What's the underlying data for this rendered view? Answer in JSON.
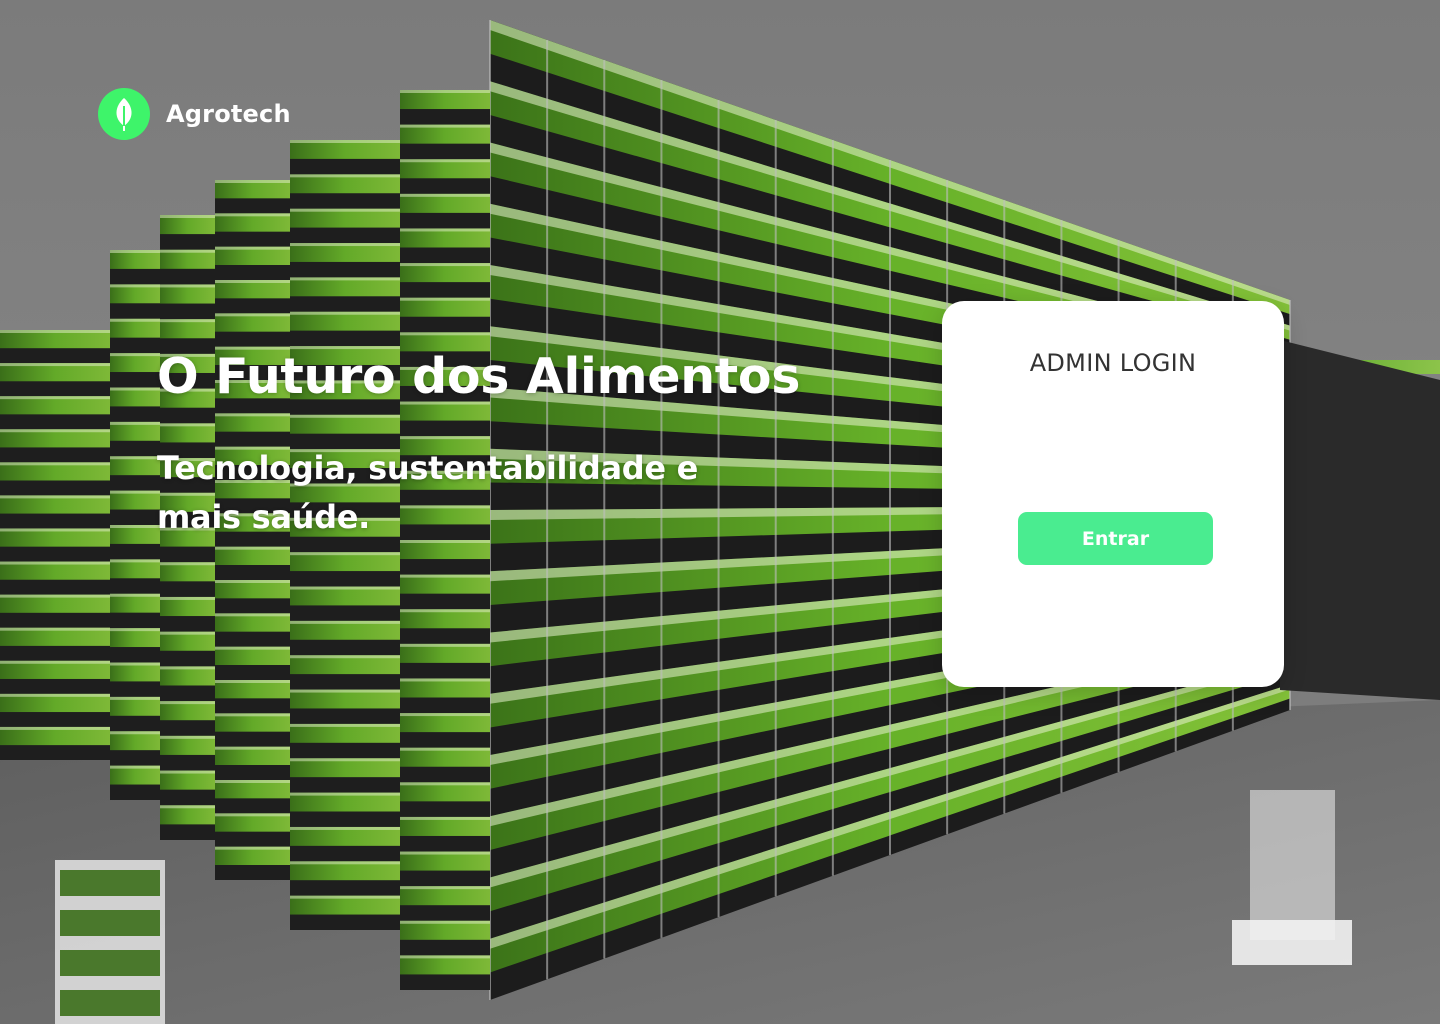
{
  "brand": {
    "name": "Agrotech",
    "logo_icon": "leaf-icon",
    "accent": "#3ef46a"
  },
  "hero": {
    "title": "O Futuro dos Alimentos",
    "subtitle": "Tecnologia, sustentabilidade e mais saúde."
  },
  "login": {
    "title": "ADMIN LOGIN",
    "submit_label": "Entrar",
    "button_color": "#4aec90"
  },
  "background": {
    "image_icon": "vertical-farm-image"
  }
}
